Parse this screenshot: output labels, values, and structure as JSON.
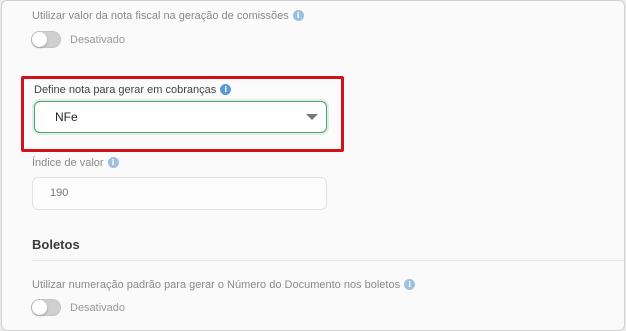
{
  "settings": {
    "commission_setting": {
      "label": "Utilizar valor da nota fiscal na geração de comissões",
      "toggle_state": "Desativado"
    },
    "billing_note": {
      "label": "Define nota para gerar em cobranças",
      "selected": "NFe"
    },
    "value_index": {
      "label": "Índice de valor",
      "value": "190"
    },
    "boletos_section": {
      "title": "Boletos",
      "numbering_setting": {
        "label": "Utilizar numeração padrão para gerar o Número do Documento nos boletos",
        "toggle_state": "Desativado"
      }
    }
  },
  "icons": {
    "info": "info-icon"
  },
  "colors": {
    "highlight_border": "#d0121b",
    "select_focus": "#49a66d",
    "info_icon": "#5b9bd5"
  }
}
